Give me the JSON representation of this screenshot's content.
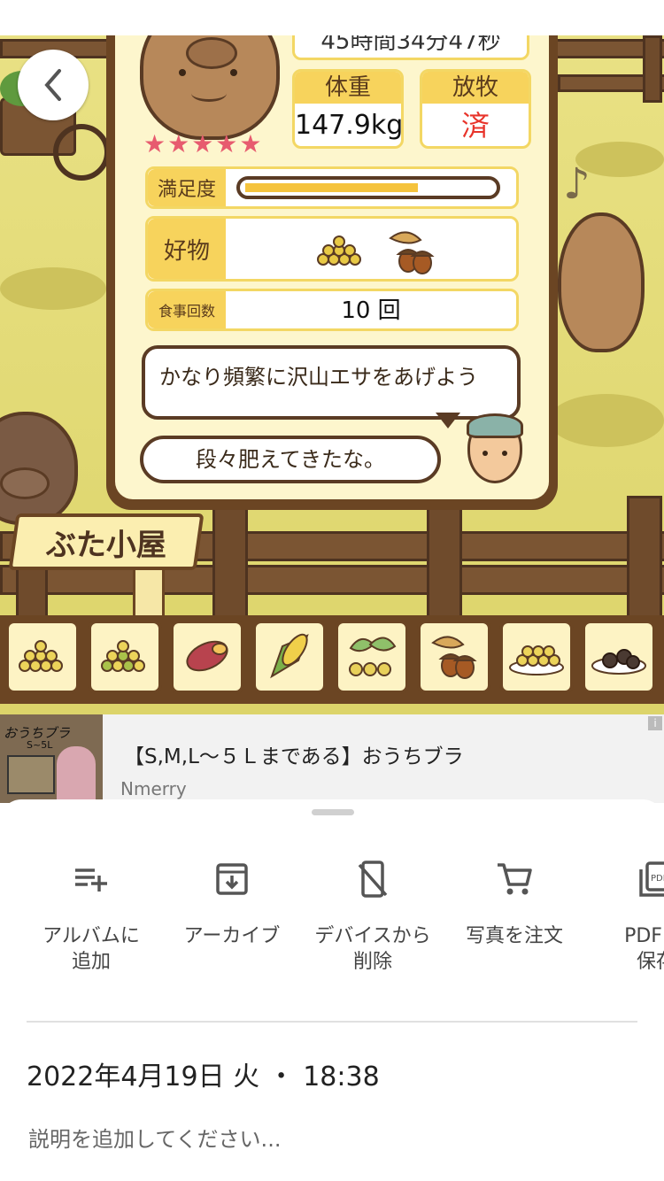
{
  "game": {
    "timer_text": "45時間34分47秒",
    "stars": "★★★★★",
    "weight_label": "体重",
    "weight_value": "147.9kg",
    "graze_label": "放牧",
    "graze_value": "済",
    "satisfaction_label": "満足度",
    "satisfaction_level": 0.7,
    "favorite_label": "好物",
    "favorites": [
      "grain-pile-icon",
      "acorn-icon"
    ],
    "meal_count_label": "食事回数",
    "meal_count_value": "10 回",
    "speech_1": "かなり頻繁に沢山エサをあげよう",
    "speech_2": "段々肥えてきたな。",
    "sign_text": "ぶた小屋",
    "feed_items": [
      "grain-pile-icon",
      "mixed-grain-icon",
      "sweet-potato-icon",
      "corn-icon",
      "greens-beans-icon",
      "acorn-icon",
      "grain-plate-icon",
      "dark-food-plate-icon"
    ],
    "colors": {
      "gold": "#f7c84a",
      "brown": "#6b4523",
      "red": "#e8332a"
    }
  },
  "ad": {
    "title": "【S,M,L～５Ｌまである】おうちブラ",
    "advertiser": "Nmerry",
    "thumb_text": "おうちブラ",
    "thumb_sub": "S~5L"
  },
  "actions": [
    {
      "icon": "playlist-add-icon",
      "label": "アルバムに\n追加"
    },
    {
      "icon": "archive-icon",
      "label": "アーカイブ"
    },
    {
      "icon": "device-remove-icon",
      "label": "デバイスから\n削除"
    },
    {
      "icon": "cart-icon",
      "label": "写真を注文"
    },
    {
      "icon": "pdf-icon",
      "label": "PDF 形\n保存"
    }
  ],
  "photo": {
    "datetime": "2022年4月19日 火 ・ 18:38",
    "description_placeholder": "説明を追加してください..."
  }
}
